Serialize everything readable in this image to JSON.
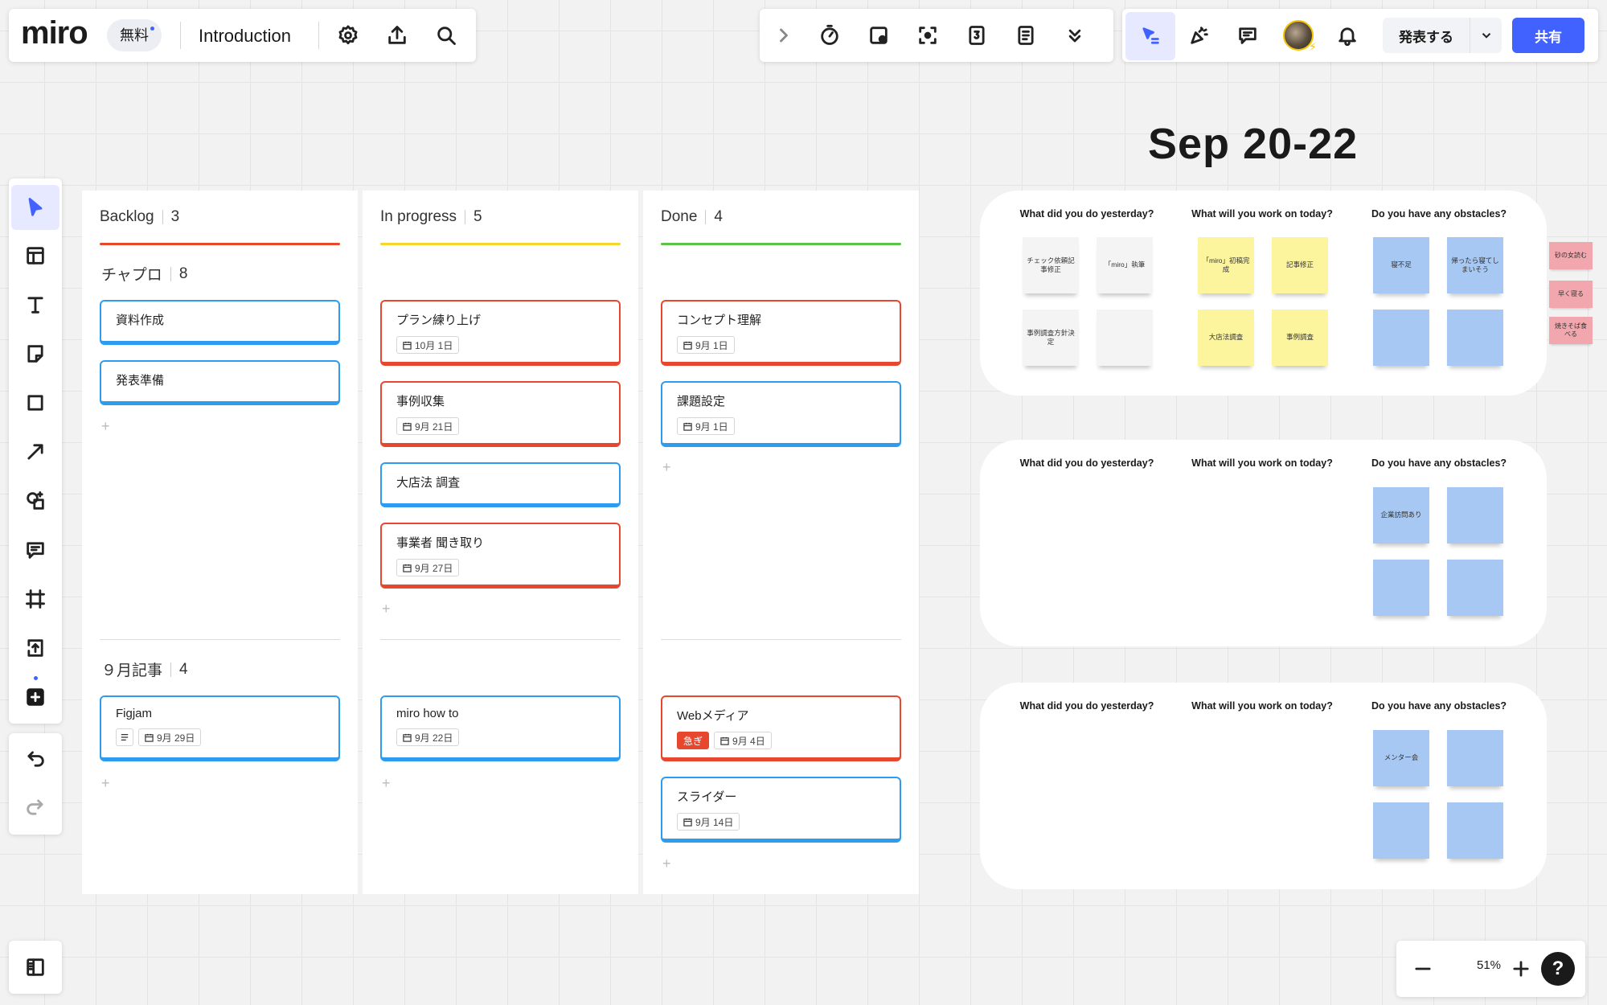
{
  "header": {
    "logo": "miro",
    "plan_badge": "無料",
    "board_title": "Introduction"
  },
  "actions": {
    "present_label": "発表する",
    "share_label": "共有"
  },
  "kanban": {
    "columns": [
      {
        "name": "Backlog",
        "count": "3",
        "color": "#e8472f"
      },
      {
        "name": "In progress",
        "count": "5",
        "color": "#f5d62c"
      },
      {
        "name": "Done",
        "count": "4",
        "color": "#5ec14a"
      }
    ],
    "swimlanes": [
      {
        "name": "チャプロ",
        "count": "8"
      },
      {
        "name": "９月記事",
        "count": "4"
      }
    ],
    "cards": {
      "backlog_1": {
        "title": "資料作成"
      },
      "backlog_2": {
        "title": "発表準備"
      },
      "backlog_3": {
        "title": "Figjam",
        "date": "9月 29日"
      },
      "progress_1": {
        "title": "プラン練り上げ",
        "date": "10月 1日"
      },
      "progress_2": {
        "title": "事例収集",
        "date": "9月 21日"
      },
      "progress_3": {
        "title": "大店法 調査"
      },
      "progress_4": {
        "title": "事業者 聞き取り",
        "date": "9月 27日"
      },
      "progress_5": {
        "title": "miro how to",
        "date": "9月 22日"
      },
      "done_1": {
        "title": "コンセプト理解",
        "date": "9月 1日"
      },
      "done_2": {
        "title": "課題設定",
        "date": "9月 1日"
      },
      "done_3": {
        "title": "Webメディア",
        "tag": "急ぎ",
        "date": "9月 4日"
      },
      "done_4": {
        "title": "スライダー",
        "date": "9月 14日"
      }
    },
    "add_symbol": "+"
  },
  "standup": {
    "title": "Sep 20-22",
    "questions": {
      "yesterday": "What did you do yesterday?",
      "today": "What will you work on today?",
      "obstacles": "Do you have any obstacles?"
    },
    "frame1": {
      "yesterday": [
        "チェック依頼記事修正",
        "「miro」執筆",
        "事例調査方針決定",
        ""
      ],
      "today": [
        "「miro」初稿完成",
        "記事修正",
        "大店法調査",
        "事例調査"
      ],
      "obstacles": [
        "寝不足",
        "帰ったら寝てしまいそう",
        "",
        ""
      ]
    },
    "frame2": {
      "obstacles": [
        "企業訪問あり",
        "",
        "",
        ""
      ]
    },
    "frame3": {
      "obstacles": [
        "メンター会",
        "",
        "",
        ""
      ]
    },
    "side_notes": [
      "砂の女読む",
      "早く寝る",
      "焼きそば食べる"
    ]
  },
  "zoom": {
    "level": "51%",
    "help": "?"
  },
  "colors": {
    "accent": "#4262ff",
    "card_blue": "#2d9bf0",
    "card_red": "#e8472f",
    "sticky_yellow": "#fdf59e",
    "sticky_blue": "#a7c8f2",
    "sticky_pink": "#f1a7ad"
  }
}
